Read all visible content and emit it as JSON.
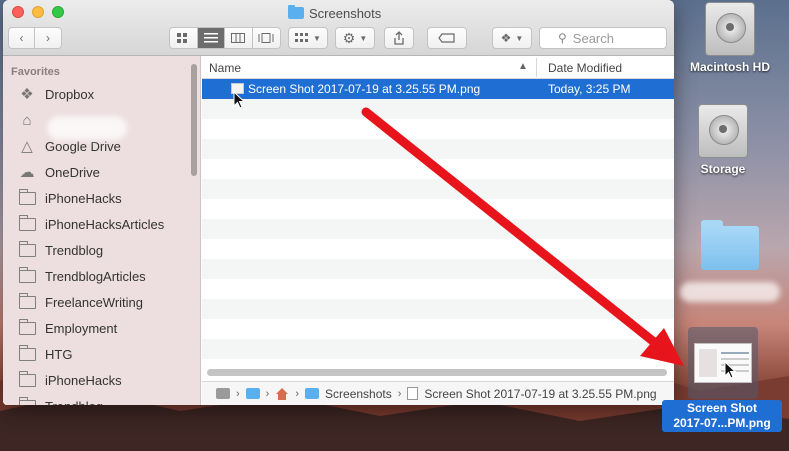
{
  "window": {
    "title": "Screenshots",
    "search_placeholder": "Search"
  },
  "sidebar": {
    "heading": "Favorites",
    "items": [
      {
        "label": "Dropbox",
        "icon": "dropbox-icon"
      },
      {
        "label": "",
        "icon": "home-icon"
      },
      {
        "label": "Google Drive",
        "icon": "google-drive-icon"
      },
      {
        "label": "OneDrive",
        "icon": "cloud-icon"
      },
      {
        "label": "iPhoneHacks",
        "icon": "folder-icon"
      },
      {
        "label": "iPhoneHacksArticles",
        "icon": "folder-icon"
      },
      {
        "label": "Trendblog",
        "icon": "folder-icon"
      },
      {
        "label": "TrendblogArticles",
        "icon": "folder-icon"
      },
      {
        "label": "FreelanceWriting",
        "icon": "folder-icon"
      },
      {
        "label": "Employment",
        "icon": "folder-icon"
      },
      {
        "label": "HTG",
        "icon": "folder-icon"
      },
      {
        "label": "iPhoneHacks",
        "icon": "folder-icon"
      },
      {
        "label": "Trendblog",
        "icon": "folder-icon"
      }
    ]
  },
  "list": {
    "col_name": "Name",
    "col_date": "Date Modified",
    "files": [
      {
        "name": "Screen Shot 2017-07-19 at 3.25.55 PM.png",
        "date": "Today, 3:25 PM",
        "selected": true
      }
    ]
  },
  "pathbar": {
    "folder": "Screenshots",
    "file": "Screen Shot 2017-07-19 at 3.25.55 PM.png"
  },
  "desktop": {
    "items": [
      {
        "label": "Macintosh HD",
        "icon": "hard-drive-icon"
      },
      {
        "label": "Storage",
        "icon": "hard-drive-icon"
      }
    ],
    "selected_file_line1": "Screen Shot",
    "selected_file_line2": "2017-07...PM.png"
  },
  "colors": {
    "selection": "#1f6ed4",
    "arrow": "#e8141b",
    "folder": "#5ab0ef"
  }
}
